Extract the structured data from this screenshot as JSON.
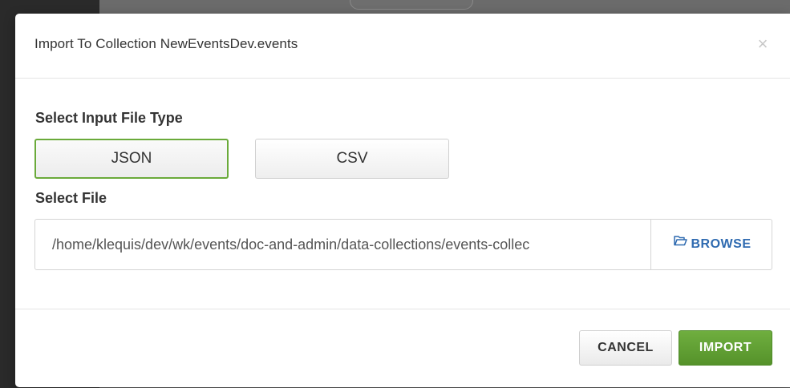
{
  "modal": {
    "title": "Import To Collection NewEventsDev.events",
    "close_glyph": "×",
    "close_icon": "close-icon"
  },
  "file_type": {
    "label": "Select Input File Type",
    "options": [
      {
        "label": "JSON",
        "selected": true
      },
      {
        "label": "CSV",
        "selected": false
      }
    ]
  },
  "file": {
    "label": "Select File",
    "path": "/home/klequis/dev/wk/events/doc-and-admin/data-collections/events-collec",
    "browse_label": "BROWSE",
    "browse_icon": "folder-open-icon"
  },
  "footer": {
    "cancel_label": "CANCEL",
    "import_label": "IMPORT"
  },
  "colors": {
    "selected_border": "#6aaa3a",
    "import_button": "#5d9b33",
    "browse_text": "#2e6ab0"
  }
}
